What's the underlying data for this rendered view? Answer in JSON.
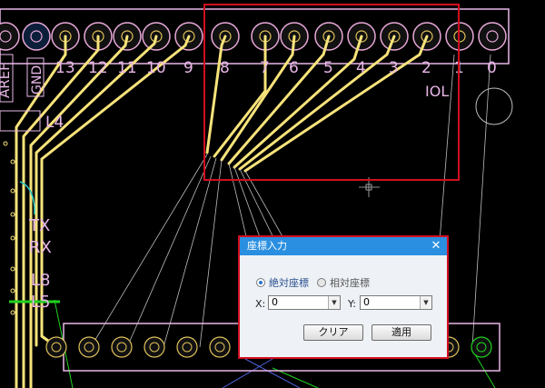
{
  "pcb": {
    "top_pin_labels": [
      "13",
      "12",
      "11",
      "10",
      "9",
      "8",
      "7",
      "6",
      "5",
      "4",
      "3",
      "2",
      "1",
      "0"
    ],
    "net_labels": {
      "aref": "AREF",
      "gnd": "GND",
      "iol": "IOL",
      "tx": "TX",
      "rx": "RX",
      "l8": "L8",
      "l5": "L5",
      "l4": "L4"
    },
    "colors": {
      "background": "#000000",
      "trace": "#f7e37a",
      "pad_outline": "#e8a8d8",
      "silkscreen": "#e9b7e8",
      "ratsnest": "#bdbdbd",
      "selection": "#d10f1f",
      "green_net": "#1fd21f"
    }
  },
  "dialog": {
    "title": "座標入力",
    "close_icon": "close-icon",
    "radio_absolute": "絶対座標",
    "radio_relative": "相対座標",
    "x_label": "X:",
    "x_value": "0",
    "y_label": "Y:",
    "y_value": "0",
    "clear_button": "クリア",
    "apply_button": "適用",
    "dropdown_icon": "chevron-down-icon"
  }
}
